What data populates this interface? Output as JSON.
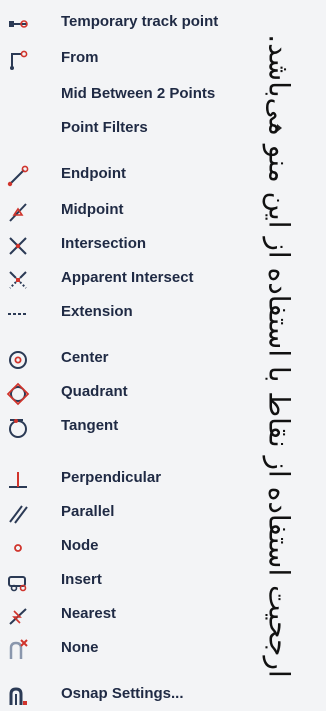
{
  "menu": {
    "items": [
      {
        "label": "Temporary track point",
        "icon": "temporary-track-point-icon"
      },
      {
        "label": "From",
        "icon": "from-icon"
      },
      {
        "label": "Mid Between 2 Points",
        "icon": ""
      },
      {
        "label": "Point Filters",
        "icon": ""
      },
      {
        "label": "Endpoint",
        "icon": "endpoint-icon"
      },
      {
        "label": "Midpoint",
        "icon": "midpoint-icon"
      },
      {
        "label": "Intersection",
        "icon": "intersection-icon"
      },
      {
        "label": "Apparent Intersect",
        "icon": "apparent-intersect-icon"
      },
      {
        "label": "Extension",
        "icon": "extension-icon"
      },
      {
        "label": "Center",
        "icon": "center-icon"
      },
      {
        "label": "Quadrant",
        "icon": "quadrant-icon"
      },
      {
        "label": "Tangent",
        "icon": "tangent-icon"
      },
      {
        "label": "Perpendicular",
        "icon": "perpendicular-icon"
      },
      {
        "label": "Parallel",
        "icon": "parallel-icon"
      },
      {
        "label": "Node",
        "icon": "node-icon"
      },
      {
        "label": "Insert",
        "icon": "insert-icon"
      },
      {
        "label": "Nearest",
        "icon": "nearest-icon"
      },
      {
        "label": "None",
        "icon": "none-icon"
      },
      {
        "label": "Osnap Settings...",
        "icon": "osnap-settings-icon"
      }
    ]
  },
  "caption": "ارجحیت استفاده از نقاط با استفاده از این منو می‌باشد.",
  "colors": {
    "label": "#1f2a44",
    "icon_red": "#d0342c",
    "icon_dark": "#2b3a55",
    "background": "#f3f4f6"
  }
}
